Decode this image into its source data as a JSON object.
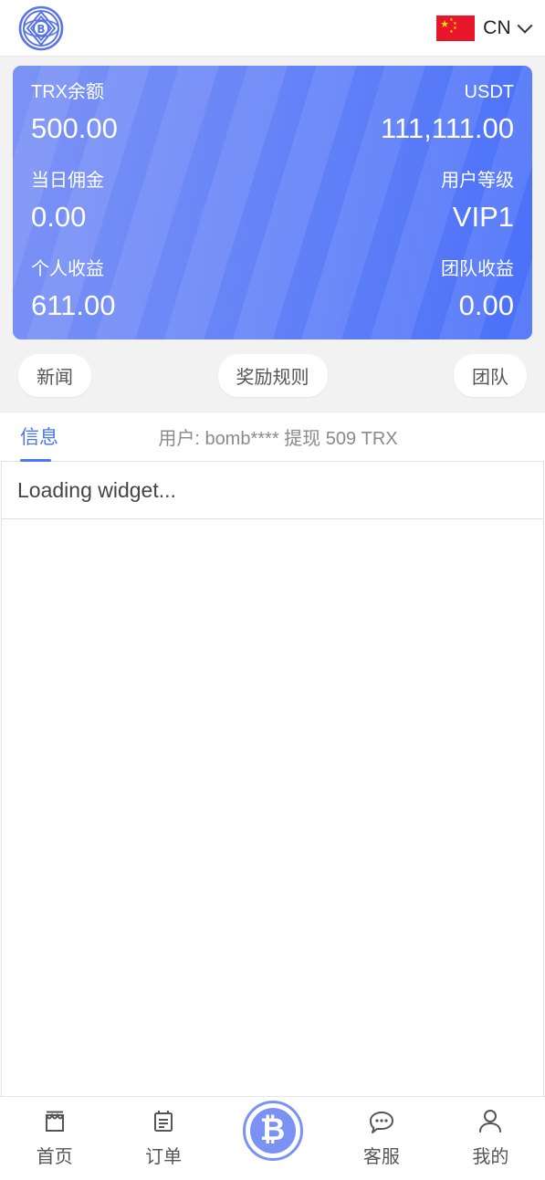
{
  "header": {
    "logo_icon": "bitcoin-emblem-logo",
    "language": {
      "flag_icon": "china-flag-icon",
      "code": "CN",
      "chevron_icon": "chevron-down-icon"
    }
  },
  "balance_card": {
    "rows": [
      {
        "left_label": "TRX余额",
        "right_label": "USDT",
        "left_value": "500.00",
        "right_value": "111,111.00"
      },
      {
        "left_label": "当日佣金",
        "right_label": "用户等级",
        "left_value": "0.00",
        "right_value": "VIP1"
      },
      {
        "left_label": "个人收益",
        "right_label": "团队收益",
        "left_value": "611.00",
        "right_value": "0.00"
      }
    ],
    "gradient_from": "#7b92f5",
    "gradient_to": "#4a70f8"
  },
  "quick_buttons": [
    {
      "label": "新闻"
    },
    {
      "label": "奖励规则"
    },
    {
      "label": "团队"
    }
  ],
  "notice_bar": {
    "tab_label": "信息",
    "marquee_text": "用户: bomb**** 提现 509 TRX",
    "accent_color": "#4a76f8"
  },
  "widget": {
    "loading_text": "Loading widget..."
  },
  "bottom_nav": {
    "items": [
      {
        "label": "首页",
        "icon": "shop-icon"
      },
      {
        "label": "订单",
        "icon": "clipboard-icon"
      },
      {
        "label": "客服",
        "icon": "chat-bubble-icon"
      },
      {
        "label": "我的",
        "icon": "person-icon"
      }
    ],
    "center": {
      "icon": "bitcoin-icon",
      "symbol": "₿"
    }
  }
}
